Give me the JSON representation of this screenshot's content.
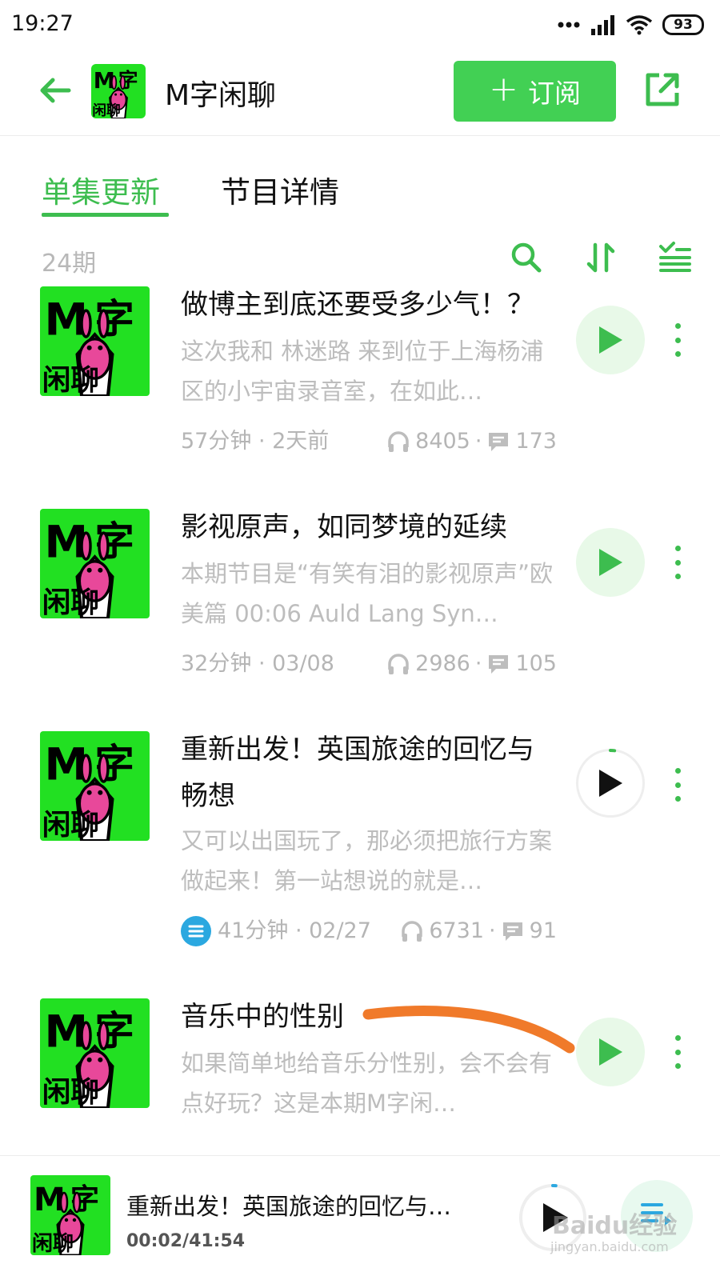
{
  "status_bar": {
    "time": "19:27",
    "battery": "93"
  },
  "header": {
    "title": "M字闲聊",
    "subscribe_label": "订阅"
  },
  "tabs": [
    {
      "label": "单集更新",
      "active": true
    },
    {
      "label": "节目详情",
      "active": false
    }
  ],
  "list": {
    "count": "24期"
  },
  "episodes": [
    {
      "title": "做博主到底还要受多少气！？",
      "description": "这次我和 林迷路 来到位于上海杨浦区的小宇宙录音室，在如此…",
      "duration_date": "57分钟 · 2天前",
      "plays": "8405",
      "comments": "173"
    },
    {
      "title": "影视原声，如同梦境的延续",
      "description": "本期节目是“有笑有泪的影视原声”欧美篇 00:06 Auld Lang Syn…",
      "duration_date": "32分钟 · 03/08",
      "plays": "2986",
      "comments": "105"
    },
    {
      "title": "重新出发！英国旅途的回忆与畅想",
      "description": "又可以出国玩了，那必须把旅行方案做起来！第一站想说的就是…",
      "duration_date": "41分钟 · 02/27",
      "plays": "6731",
      "comments": "91",
      "progress": 0.02
    },
    {
      "title": "音乐中的性别",
      "description": "如果简单地给音乐分性别，会不会有点好玩？这是本期M字闲…"
    }
  ],
  "player": {
    "title": "重新出发！英国旅途的回忆与…",
    "time": "00:02/41:54",
    "progress": 0.01
  },
  "watermark": {
    "text": "Baidu经验",
    "sub": "jingyan.baidu.com"
  },
  "cover_art": {
    "big_letter": "M",
    "char": "字",
    "bottom": "闲聊"
  },
  "colors": {
    "accent": "#42d054",
    "brand_text": "#3dbd4f",
    "annotation": "#f07a2a",
    "cover_bg": "#22e022",
    "rabbit": "#e8489a"
  },
  "icons": [
    "back-arrow-icon",
    "share-icon",
    "search-icon",
    "sort-icon",
    "filter-icon",
    "play-icon",
    "more-icon",
    "headphones-icon",
    "comment-icon",
    "notes-icon",
    "playlist-icon",
    "signal-icon",
    "wifi-icon"
  ]
}
